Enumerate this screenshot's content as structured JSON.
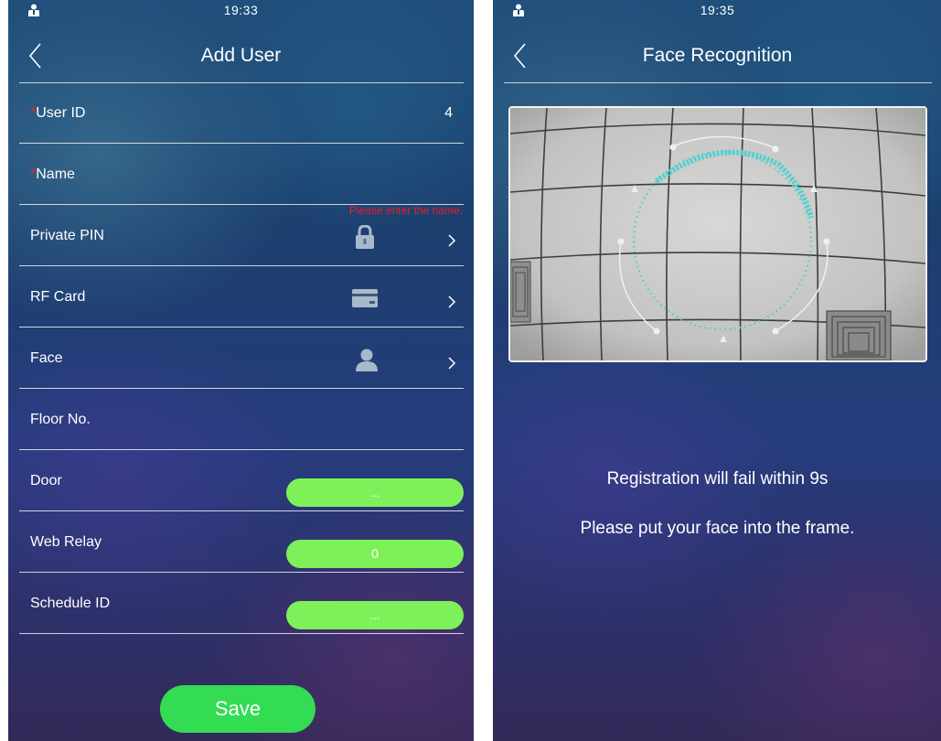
{
  "add_user": {
    "status": {
      "time": "19:33",
      "icon": "user-badge-icon"
    },
    "title": "Add User",
    "required_mark": "*",
    "rows": {
      "user_id": {
        "label": "User ID",
        "value": "4"
      },
      "name": {
        "label": "Name",
        "value": ""
      },
      "private_pin": {
        "label": "Private PIN",
        "hint": "Please enter the name.",
        "icon": "lock-icon"
      },
      "rf_card": {
        "label": "RF Card",
        "icon": "card-icon"
      },
      "face": {
        "label": "Face",
        "icon": "person-icon"
      },
      "floor_no": {
        "label": "Floor No.",
        "value": ""
      },
      "door": {
        "label": "Door",
        "value": "..."
      },
      "web_relay": {
        "label": "Web Relay",
        "value": "0"
      },
      "schedule_id": {
        "label": "Schedule ID",
        "value": "..."
      }
    },
    "save_label": "Save"
  },
  "face_recognition": {
    "status": {
      "time": "19:35",
      "icon": "user-badge-icon"
    },
    "title": "Face Recognition",
    "messages": {
      "timeout": "Registration will fail within 9s",
      "instruction": "Please put your face into the frame."
    }
  },
  "colors": {
    "accent_green": "#7ef15a",
    "save_green": "#33dc52",
    "required_red": "#e0242a",
    "scan_cyan": "#4cd0d0"
  }
}
